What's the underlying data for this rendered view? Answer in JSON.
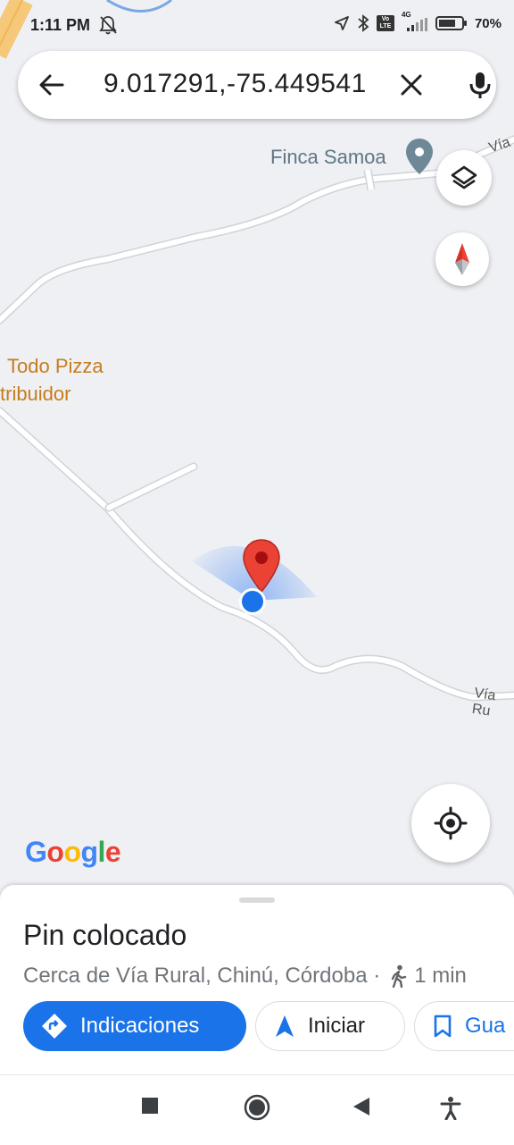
{
  "status_bar": {
    "time": "1:11 PM",
    "battery_percent": "70%",
    "network": "4G",
    "volte": "Vo LTE",
    "icons": [
      "alarm-off-icon",
      "location-icon",
      "bluetooth-icon",
      "volte-icon",
      "signal-icon",
      "battery-icon"
    ]
  },
  "search": {
    "query": "9.017291,-75.449541",
    "back_icon": "arrow-back-icon",
    "clear_icon": "close-icon",
    "mic_icon": "mic-icon"
  },
  "map": {
    "places": [
      {
        "name": "Finca Samoa"
      },
      {
        "name": "Todo Pizza",
        "line2": "tribuidor"
      }
    ],
    "road_labels": [
      "Vía",
      "Vía Ru"
    ],
    "logo": [
      "G",
      "o",
      "o",
      "g",
      "l",
      "e"
    ],
    "logo_colors": [
      "#4285F4",
      "#EA4335",
      "#FBBC05",
      "#4285F4",
      "#34A853",
      "#EA4335"
    ]
  },
  "sheet": {
    "title": "Pin colocado",
    "subtitle": "Cerca de Vía Rural, Chinú, Córdoba ·",
    "walk_time": "1 min",
    "actions": [
      {
        "label": "Indicaciones",
        "icon": "directions-icon"
      },
      {
        "label": "Iniciar",
        "icon": "navigation-arrow-icon"
      },
      {
        "label": "Gua",
        "icon": "bookmark-icon"
      }
    ]
  },
  "colors": {
    "accent": "#1a73e8",
    "pin": "#ea4335",
    "poi_orange": "#c77b1d",
    "poi_gray": "#5f7686"
  }
}
